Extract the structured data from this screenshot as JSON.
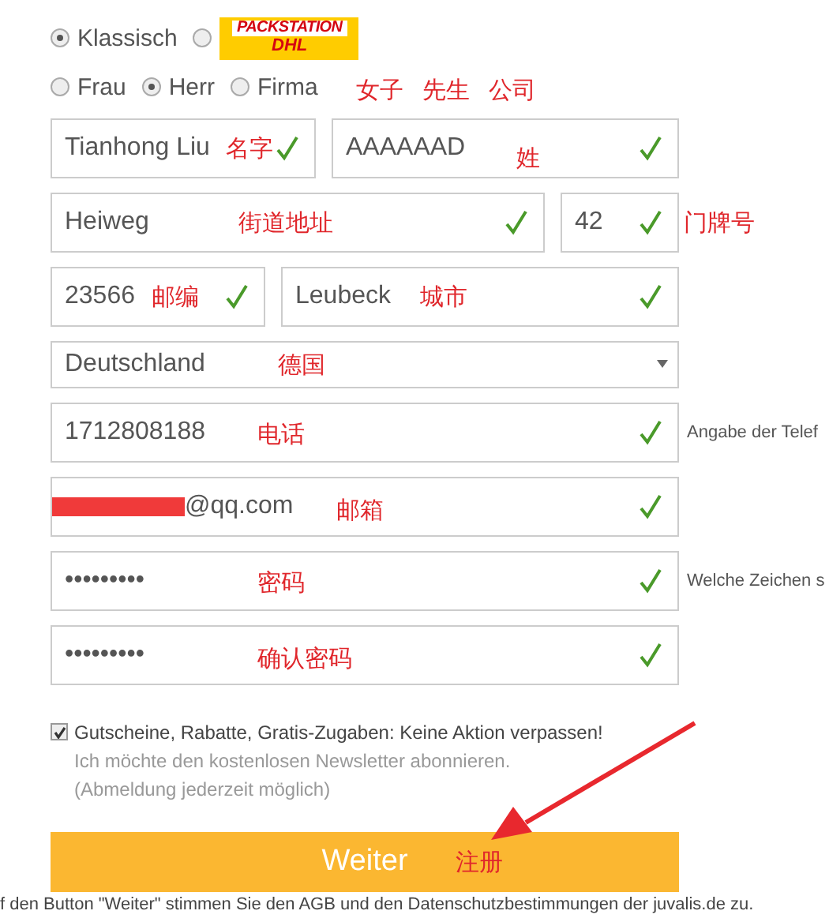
{
  "delivery_options": [
    {
      "kind": "text",
      "label": "Klassisch",
      "selected": true
    },
    {
      "kind": "logo",
      "logo_lines": [
        "PACKSTATION",
        "DHL"
      ],
      "selected": false
    }
  ],
  "salutations": [
    {
      "label": "Frau",
      "selected": false
    },
    {
      "label": "Herr",
      "selected": true
    },
    {
      "label": "Firma",
      "selected": false
    }
  ],
  "salutation_annotations": [
    "女子",
    "先生",
    "公司"
  ],
  "rows": [
    {
      "fields": [
        {
          "kind": "text",
          "value": "Tianhong Liu",
          "annotation": "名字",
          "valid": true
        },
        {
          "kind": "text",
          "value": "AAAAAAD",
          "annotation": "姓",
          "valid": true
        }
      ]
    },
    {
      "fields": [
        {
          "kind": "text",
          "value": "Heiweg",
          "annotation": "街道地址",
          "valid": true
        },
        {
          "kind": "text",
          "value": "42",
          "annotation": "门牌号",
          "valid": true
        }
      ]
    },
    {
      "fields": [
        {
          "kind": "text",
          "value": "23566",
          "annotation": "邮编",
          "valid": true
        },
        {
          "kind": "text",
          "value": "Leubeck",
          "annotation": "城市",
          "valid": true
        }
      ]
    },
    {
      "fields": [
        {
          "kind": "select",
          "value": "Deutschland",
          "annotation": "德国"
        }
      ]
    },
    {
      "fields": [
        {
          "kind": "text",
          "value": "1712808188",
          "annotation": "电话",
          "valid": true
        }
      ],
      "hint": "Angabe der Telef"
    },
    {
      "fields": [
        {
          "kind": "email",
          "redacted": true,
          "value": "@qq.com",
          "annotation": "邮箱",
          "valid": true
        }
      ]
    },
    {
      "fields": [
        {
          "kind": "password",
          "value": "•••••••••",
          "annotation": "密码",
          "valid": true
        }
      ],
      "hint": "Welche Zeichen s"
    },
    {
      "fields": [
        {
          "kind": "password",
          "value": "•••••••••",
          "annotation": "确认密码",
          "valid": true
        }
      ]
    }
  ],
  "newsletter": {
    "checked": true,
    "headline": "Gutscheine, Rabatte, Gratis-Zugaben: Keine Aktion verpassen!",
    "lines": [
      "Ich möchte den kostenlosen Newsletter abonnieren.",
      "(Abmeldung jederzeit möglich)"
    ]
  },
  "submit": {
    "label": "Weiter",
    "annotation": "注册"
  },
  "footer": "f den Button \"Weiter\" stimmen Sie den AGB und den Datenschutzbestimmungen der juvalis.de zu."
}
